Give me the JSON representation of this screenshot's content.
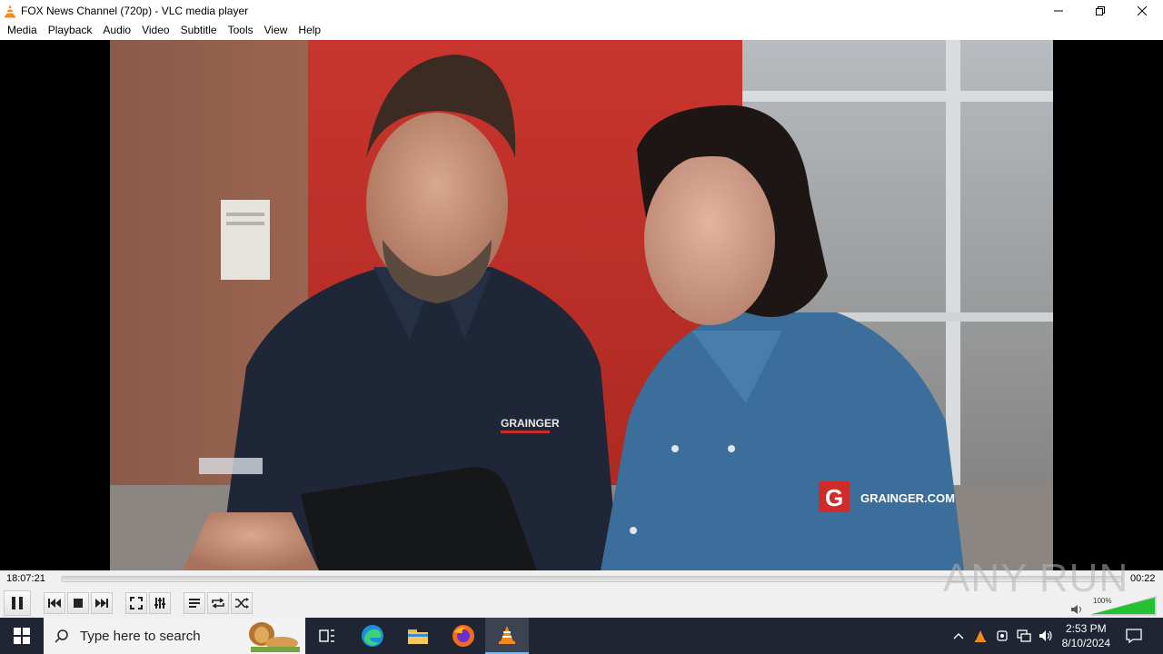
{
  "window": {
    "title": "FOX News Channel (720p) - VLC media player",
    "buttons": {
      "minimize": "minimize-icon",
      "maximize": "restore-icon",
      "close": "close-icon"
    }
  },
  "menu": [
    "Media",
    "Playback",
    "Audio",
    "Video",
    "Subtitle",
    "Tools",
    "View",
    "Help"
  ],
  "video": {
    "overlay_brand": "GRAINGER.COM",
    "shirt_logo": "GRAINGER"
  },
  "player": {
    "elapsed": "18:07:21",
    "remaining": "00:22",
    "volume": "100%",
    "progress": 0.0
  },
  "watermark": "ANY RUN",
  "taskbar": {
    "search_placeholder": "Type here to search",
    "time": "2:53 PM",
    "date": "8/10/2024"
  },
  "colors": {
    "vlc_orange": "#f08a1c",
    "volume_green": "#22c232",
    "taskbar": "#1f2532"
  }
}
